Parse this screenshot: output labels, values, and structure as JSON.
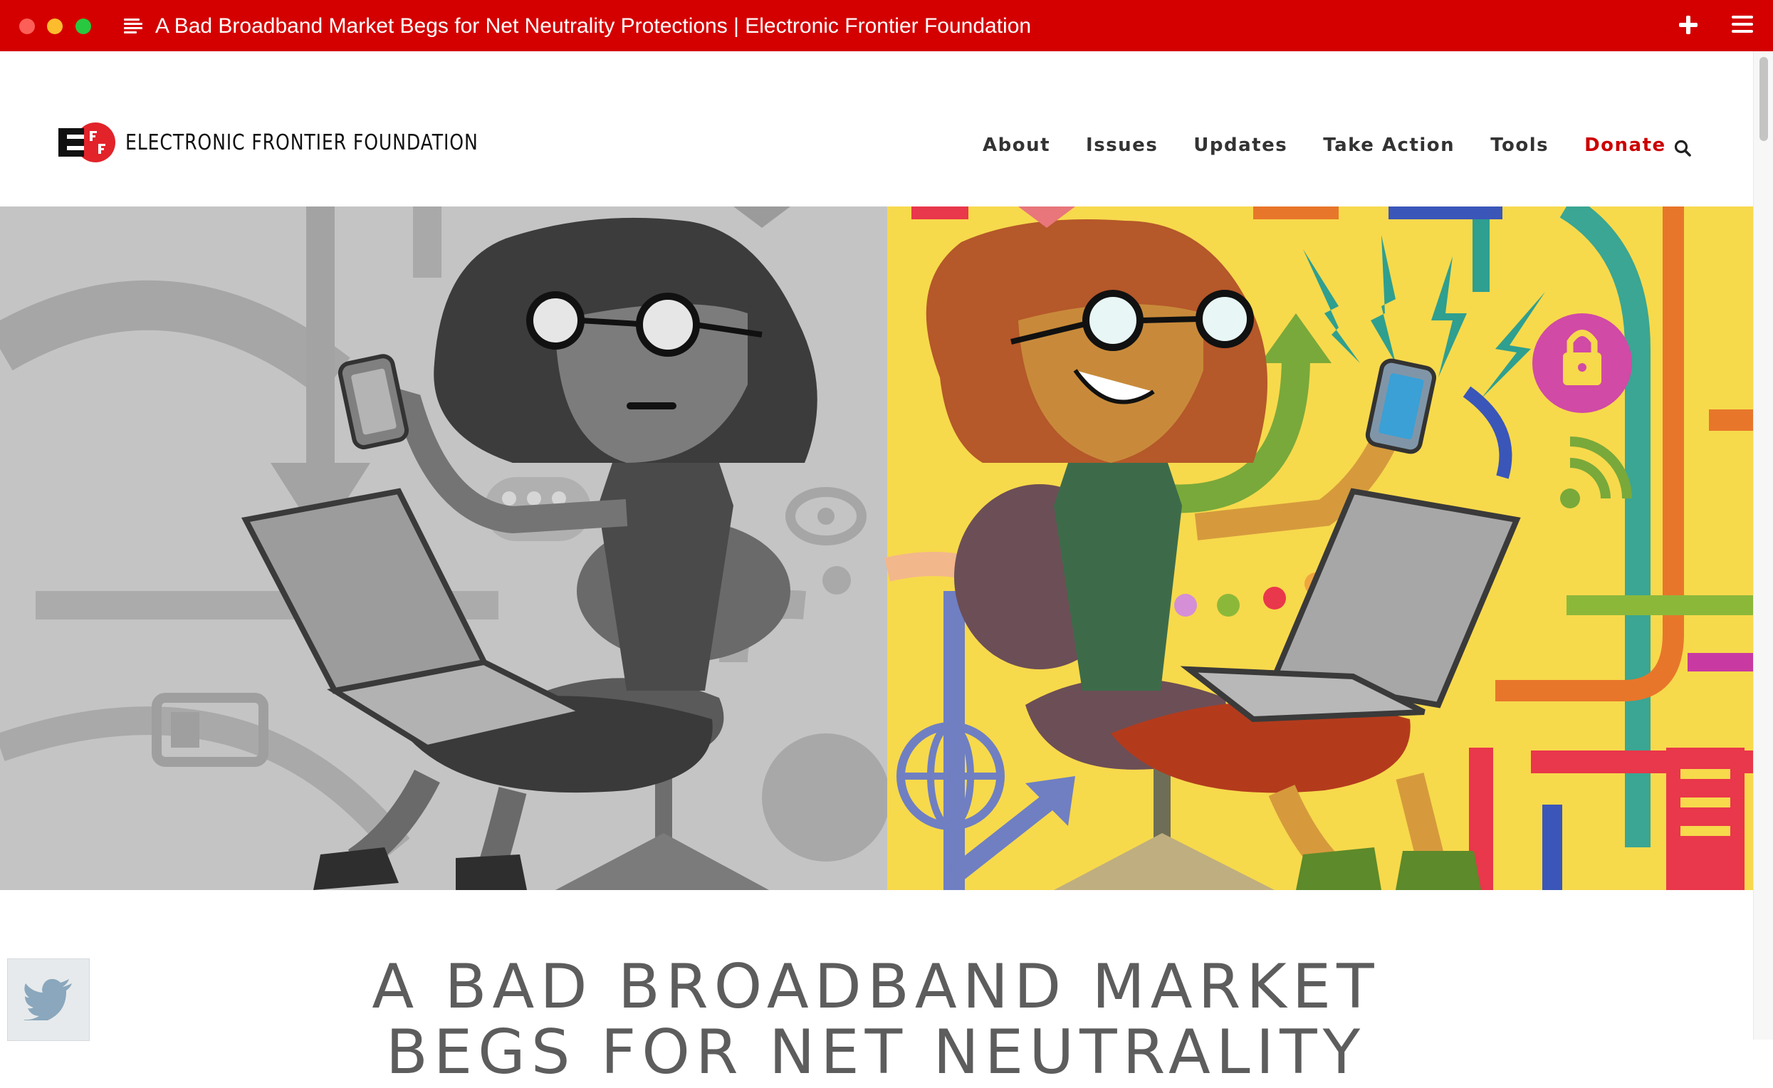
{
  "window": {
    "title": "A Bad Broadband Market Begs for Net Neutrality Protections | Electronic Frontier Foundation"
  },
  "header": {
    "logo_text": "ELECTRONIC FRONTIER FOUNDATION",
    "nav": [
      "About",
      "Issues",
      "Updates",
      "Take Action",
      "Tools",
      "Donate"
    ]
  },
  "article": {
    "title": "A BAD BROADBAND MARKET BEGS FOR NET NEUTRALITY"
  },
  "colors": {
    "titlebar": "#d40000",
    "donate": "#cc0000",
    "hero_right_bg": "#f7d94c"
  },
  "icons": {
    "share": "twitter-icon",
    "nav_search": "search-icon"
  }
}
